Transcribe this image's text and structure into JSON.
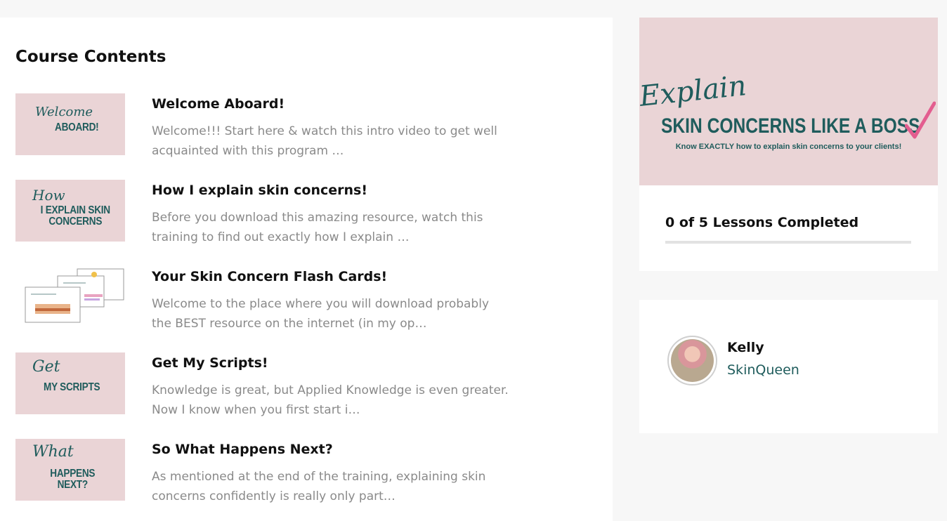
{
  "course": {
    "heading": "Course Contents",
    "lessons": [
      {
        "title": "Welcome Aboard!",
        "description": "Welcome!!! Start here & watch this intro video to get well acquainted with this program …",
        "thumb_script": "Welcome",
        "thumb_caps": "ABOARD!"
      },
      {
        "title": "How I explain skin concerns!",
        "description": "Before you download this amazing resource, watch this training to find out exactly how I explain …",
        "thumb_script": "How",
        "thumb_caps": "I EXPLAIN SKIN CONCERNS"
      },
      {
        "title": "Your Skin Concern Flash Cards!",
        "description": "Welcome to the place where you will download probably the BEST resource on the internet (in my op…"
      },
      {
        "title": "Get My Scripts!",
        "description": "Knowledge is great, but Applied Knowledge is even greater. Now I know when you first start i…",
        "thumb_script": "Get",
        "thumb_caps": "MY SCRIPTS"
      },
      {
        "title": "So What Happens Next?",
        "description": "As mentioned at the end of the training, explaining skin concerns confidently is really only part…",
        "thumb_script": "What",
        "thumb_caps": "HAPPENS NEXT?"
      }
    ]
  },
  "sidebar": {
    "banner": {
      "script": "Explain",
      "headline": "SKIN CONCERNS LIKE A BOSS",
      "subline": "Know EXACTLY how to explain skin concerns to your clients!"
    },
    "progress": {
      "label": "0 of 5 Lessons Completed",
      "completed": 0,
      "total": 5
    },
    "author": {
      "name": "Kelly",
      "handle": "SkinQueen"
    }
  },
  "colors": {
    "accent": "#1f5c5c",
    "thumb_bg": "#ead4d6",
    "checkmark": "#e35d8f"
  }
}
